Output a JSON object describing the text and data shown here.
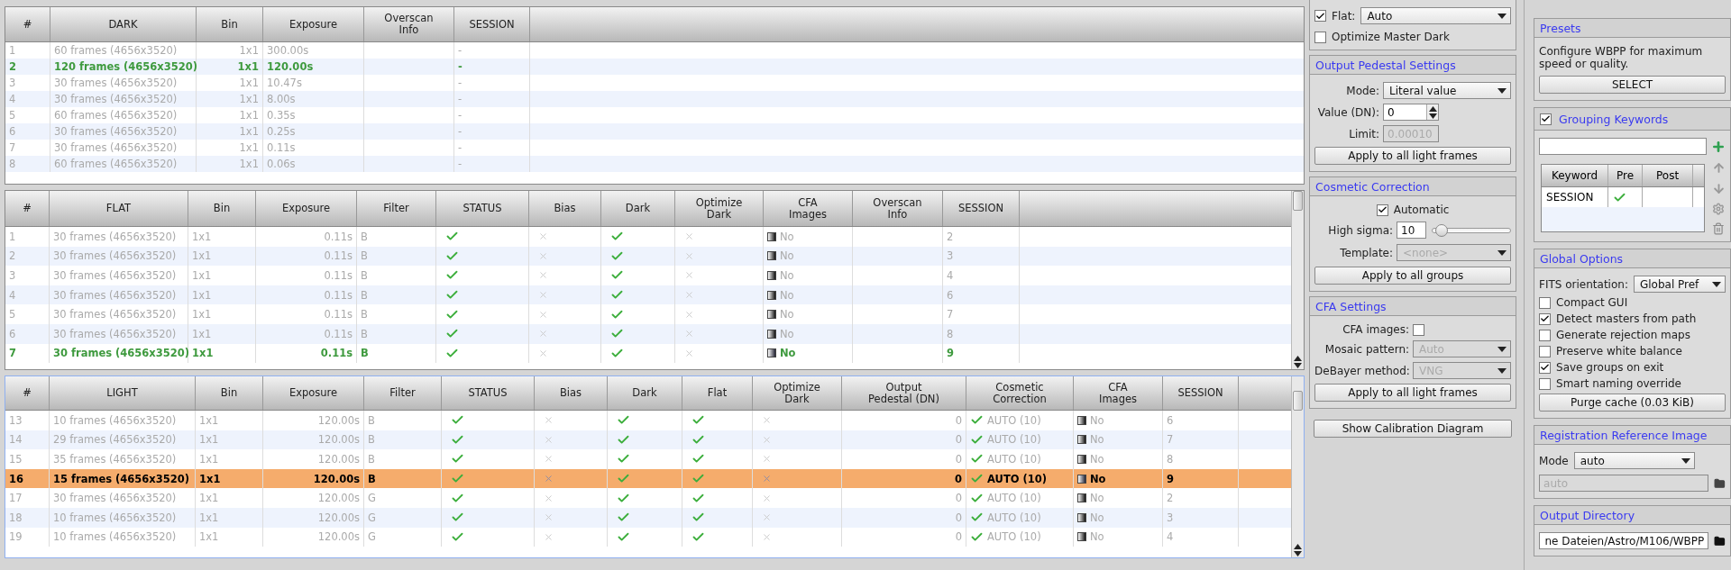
{
  "dark_table": {
    "columns": [
      "#",
      "DARK",
      "Bin",
      "Exposure",
      "Overscan\nInfo",
      "SESSION"
    ],
    "rows": [
      {
        "index": "1",
        "frames": "60 frames (4656x3520)",
        "bin": "1x1",
        "exposure": "300.00s",
        "session": "-",
        "selected": false
      },
      {
        "index": "2",
        "frames": "120 frames (4656x3520)",
        "bin": "1x1",
        "exposure": "120.00s",
        "session": "-",
        "selected": true
      },
      {
        "index": "3",
        "frames": "30 frames (4656x3520)",
        "bin": "1x1",
        "exposure": "10.47s",
        "session": "-",
        "selected": false
      },
      {
        "index": "4",
        "frames": "30 frames (4656x3520)",
        "bin": "1x1",
        "exposure": "8.00s",
        "session": "-",
        "selected": false
      },
      {
        "index": "5",
        "frames": "60 frames (4656x3520)",
        "bin": "1x1",
        "exposure": "0.35s",
        "session": "-",
        "selected": false
      },
      {
        "index": "6",
        "frames": "30 frames (4656x3520)",
        "bin": "1x1",
        "exposure": "0.25s",
        "session": "-",
        "selected": false
      },
      {
        "index": "7",
        "frames": "30 frames (4656x3520)",
        "bin": "1x1",
        "exposure": "0.11s",
        "session": "-",
        "selected": false
      },
      {
        "index": "8",
        "frames": "60 frames (4656x3520)",
        "bin": "1x1",
        "exposure": "0.06s",
        "session": "-",
        "selected": false
      }
    ]
  },
  "flat_table": {
    "columns": [
      "#",
      "FLAT",
      "Bin",
      "Exposure",
      "Filter",
      "STATUS",
      "Bias",
      "Dark",
      "Optimize\nDark",
      "CFA\nImages",
      "Overscan\nInfo",
      "SESSION"
    ],
    "rows": [
      {
        "index": "1",
        "frames": "30 frames (4656x3520)",
        "bin": "1x1",
        "exposure": "0.11s",
        "filter": "B",
        "status": true,
        "bias": false,
        "dark": true,
        "optimize_dark": false,
        "cfa": "No",
        "session": "2",
        "selected": false
      },
      {
        "index": "2",
        "frames": "30 frames (4656x3520)",
        "bin": "1x1",
        "exposure": "0.11s",
        "filter": "B",
        "status": true,
        "bias": false,
        "dark": true,
        "optimize_dark": false,
        "cfa": "No",
        "session": "3",
        "selected": false
      },
      {
        "index": "3",
        "frames": "30 frames (4656x3520)",
        "bin": "1x1",
        "exposure": "0.11s",
        "filter": "B",
        "status": true,
        "bias": false,
        "dark": true,
        "optimize_dark": false,
        "cfa": "No",
        "session": "4",
        "selected": false
      },
      {
        "index": "4",
        "frames": "30 frames (4656x3520)",
        "bin": "1x1",
        "exposure": "0.11s",
        "filter": "B",
        "status": true,
        "bias": false,
        "dark": true,
        "optimize_dark": false,
        "cfa": "No",
        "session": "6",
        "selected": false
      },
      {
        "index": "5",
        "frames": "30 frames (4656x3520)",
        "bin": "1x1",
        "exposure": "0.11s",
        "filter": "B",
        "status": true,
        "bias": false,
        "dark": true,
        "optimize_dark": false,
        "cfa": "No",
        "session": "7",
        "selected": false
      },
      {
        "index": "6",
        "frames": "30 frames (4656x3520)",
        "bin": "1x1",
        "exposure": "0.11s",
        "filter": "B",
        "status": true,
        "bias": false,
        "dark": true,
        "optimize_dark": false,
        "cfa": "No",
        "session": "8",
        "selected": false
      },
      {
        "index": "7",
        "frames": "30 frames (4656x3520)",
        "bin": "1x1",
        "exposure": "0.11s",
        "filter": "B",
        "status": true,
        "bias": false,
        "dark": true,
        "optimize_dark": false,
        "cfa": "No",
        "session": "9",
        "selected": true
      }
    ]
  },
  "light_table": {
    "columns": [
      "#",
      "LIGHT",
      "Bin",
      "Exposure",
      "Filter",
      "STATUS",
      "Bias",
      "Dark",
      "Flat",
      "Optimize\nDark",
      "Output\nPedestal (DN)",
      "Cosmetic\nCorrection",
      "CFA\nImages",
      "SESSION"
    ],
    "rows": [
      {
        "index": "13",
        "frames": "10 frames (4656x3520)",
        "bin": "1x1",
        "exposure": "120.00s",
        "filter": "B",
        "status": true,
        "bias": false,
        "dark": true,
        "flat": true,
        "optimize_dark": false,
        "pedestal": "0",
        "cosmetic": true,
        "cosmetic_text": "AUTO (10)",
        "cfa": "No",
        "session": "6",
        "selected": false
      },
      {
        "index": "14",
        "frames": "29 frames (4656x3520)",
        "bin": "1x1",
        "exposure": "120.00s",
        "filter": "B",
        "status": true,
        "bias": false,
        "dark": true,
        "flat": true,
        "optimize_dark": false,
        "pedestal": "0",
        "cosmetic": true,
        "cosmetic_text": "AUTO (10)",
        "cfa": "No",
        "session": "7",
        "selected": false
      },
      {
        "index": "15",
        "frames": "35 frames (4656x3520)",
        "bin": "1x1",
        "exposure": "120.00s",
        "filter": "B",
        "status": true,
        "bias": false,
        "dark": true,
        "flat": true,
        "optimize_dark": false,
        "pedestal": "0",
        "cosmetic": true,
        "cosmetic_text": "AUTO (10)",
        "cfa": "No",
        "session": "8",
        "selected": false
      },
      {
        "index": "16",
        "frames": "15 frames (4656x3520)",
        "bin": "1x1",
        "exposure": "120.00s",
        "filter": "B",
        "status": true,
        "bias": false,
        "dark": true,
        "flat": true,
        "optimize_dark": false,
        "pedestal": "0",
        "cosmetic": true,
        "cosmetic_text": "AUTO (10)",
        "cfa": "No",
        "session": "9",
        "selected": true
      },
      {
        "index": "17",
        "frames": "30 frames (4656x3520)",
        "bin": "1x1",
        "exposure": "120.00s",
        "filter": "G",
        "status": true,
        "bias": false,
        "dark": true,
        "flat": true,
        "optimize_dark": false,
        "pedestal": "0",
        "cosmetic": true,
        "cosmetic_text": "AUTO (10)",
        "cfa": "No",
        "session": "2",
        "selected": false
      },
      {
        "index": "18",
        "frames": "10 frames (4656x3520)",
        "bin": "1x1",
        "exposure": "120.00s",
        "filter": "G",
        "status": true,
        "bias": false,
        "dark": true,
        "flat": true,
        "optimize_dark": false,
        "pedestal": "0",
        "cosmetic": true,
        "cosmetic_text": "AUTO (10)",
        "cfa": "No",
        "session": "3",
        "selected": false
      },
      {
        "index": "19",
        "frames": "10 frames (4656x3520)",
        "bin": "1x1",
        "exposure": "120.00s",
        "filter": "G",
        "status": true,
        "bias": false,
        "dark": true,
        "flat": true,
        "optimize_dark": false,
        "pedestal": "0",
        "cosmetic": true,
        "cosmetic_text": "AUTO (10)",
        "cfa": "No",
        "session": "4",
        "selected": false
      }
    ]
  },
  "calibration": {
    "flat": {
      "label": "Flat:",
      "checked": true,
      "value": "Auto"
    },
    "optimize": {
      "label": "Optimize Master Dark",
      "checked": false
    }
  },
  "output_pedestal": {
    "title": "Output Pedestal Settings",
    "fields": [
      {
        "kind": "select",
        "label": "Mode:",
        "value": "Literal value",
        "disabled": false
      },
      {
        "kind": "spin",
        "label": "Value (DN):",
        "value": "0",
        "disabled": false
      },
      {
        "kind": "input",
        "label": "Limit:",
        "value": "0.00010",
        "disabled": true
      }
    ],
    "button": "Apply to all light frames"
  },
  "cosmetic_correction": {
    "title": "Cosmetic Correction",
    "automatic": {
      "label": "Automatic",
      "checked": true
    },
    "high_sigma": {
      "label": "High sigma:",
      "value": "10",
      "level": 0.12
    },
    "template": {
      "label": "Template:",
      "value": "<none>",
      "disabled": true
    },
    "button": "Apply to all groups"
  },
  "cfa_settings": {
    "title": "CFA Settings",
    "cfa_images": {
      "label": "CFA images:",
      "checked": false
    },
    "fields": [
      {
        "label": "Mosaic pattern:",
        "value": "Auto",
        "disabled": true
      },
      {
        "label": "DeBayer method:",
        "value": "VNG",
        "disabled": true
      }
    ],
    "button": "Apply to all light frames"
  },
  "show_diagram_button": "Show Calibration Diagram",
  "presets": {
    "title": "Presets",
    "description": "Configure WBPP for maximum speed or quality.",
    "button": "SELECT"
  },
  "grouping_keywords": {
    "title": "Grouping Keywords",
    "checked": true,
    "columns": [
      "Keyword",
      "Pre",
      "Post"
    ],
    "rows": [
      {
        "keyword": "SESSION",
        "pre": true,
        "post": false
      }
    ]
  },
  "global_options": {
    "title": "Global Options",
    "fits_label": "FITS orientation:",
    "fits_value": "Global Pref",
    "options": [
      {
        "label": "Compact GUI",
        "checked": false
      },
      {
        "label": "Detect masters from path",
        "checked": true
      },
      {
        "label": "Generate rejection maps",
        "checked": false
      },
      {
        "label": "Preserve white balance",
        "checked": false
      },
      {
        "label": "Save groups on exit",
        "checked": true
      },
      {
        "label": "Smart naming override",
        "checked": false
      }
    ],
    "button": "Purge cache (0.03 KiB)"
  },
  "registration_reference": {
    "title": "Registration Reference Image",
    "mode_label": "Mode",
    "mode": "auto",
    "path": "auto",
    "path_disabled": true
  },
  "output_directory": {
    "title": "Output Directory",
    "path": "ne Dateien/Astro/M106/WBPP"
  }
}
